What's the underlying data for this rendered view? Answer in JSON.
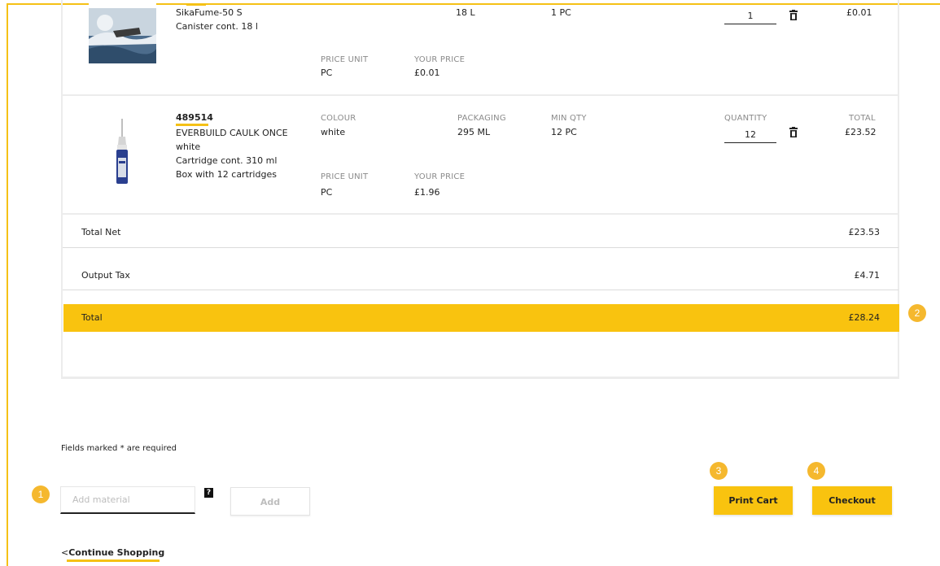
{
  "items": [
    {
      "name": "SikaFume-50 S",
      "desc": "Canister cont. 18 l",
      "packaging": "18 L",
      "min_qty": "1 PC",
      "price_unit_label": "PRICE UNIT",
      "price_unit": "PC",
      "your_price_label": "YOUR PRICE",
      "your_price": "£0.01",
      "quantity": "1",
      "total": "£0.01"
    },
    {
      "article": "489514",
      "name": "EVERBUILD CAULK ONCE",
      "colour_line": "white",
      "desc": "Cartridge cont. 310 ml",
      "box": "Box with 12 cartridges",
      "colour_label": "COLOUR",
      "colour": "white",
      "packaging_label": "PACKAGING",
      "packaging": "295 ML",
      "min_qty_label": "MIN QTY",
      "min_qty": "12 PC",
      "price_unit_label": "PRICE UNIT",
      "price_unit": "PC",
      "your_price_label": "YOUR PRICE",
      "your_price": "£1.96",
      "quantity_label": "QUANTITY",
      "quantity": "12",
      "total_label": "TOTAL",
      "total": "£23.52"
    }
  ],
  "summary": {
    "net_label": "Total Net",
    "net_value": "£23.53",
    "tax_label": "Output Tax",
    "tax_value": "£4.71",
    "total_label": "Total",
    "total_value": "£28.24"
  },
  "form": {
    "required_note": "Fields marked * are required",
    "material_placeholder": "Add material",
    "help": "?",
    "add_label": "Add"
  },
  "actions": {
    "print_label": "Print Cart",
    "checkout_label": "Checkout",
    "continue_prefix": "<",
    "continue_label": "Continue Shopping"
  },
  "badges": [
    "1",
    "2",
    "3",
    "4"
  ],
  "colors": {
    "accent": "#f9c30f",
    "badge": "#f5b82e"
  }
}
